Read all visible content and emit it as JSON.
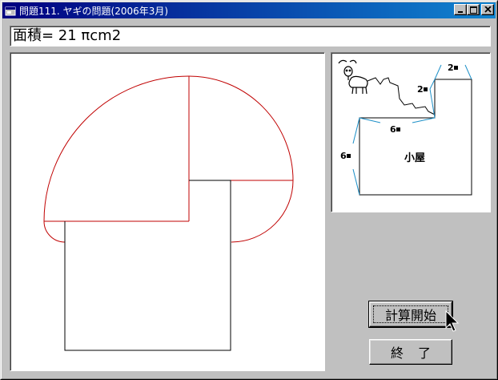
{
  "window": {
    "title": "問題111. ヤギの問題(2006年3月)",
    "title_color": "#000080",
    "controls": [
      "minimize-icon",
      "maximize-icon",
      "close-icon"
    ]
  },
  "result": {
    "text": "面積= 21  πcm2"
  },
  "diagram": {
    "labels": {
      "top_right": "2",
      "right_step": "2",
      "top_edge": "6",
      "left_edge": "6",
      "hut": "小屋"
    },
    "line_color": "#1e90c8",
    "goat_icon": "goat-icon"
  },
  "canvas": {
    "circle_color": "#c00000",
    "square_color": "#000000"
  },
  "buttons": {
    "start_label": "計算開始",
    "end_label": "終了"
  }
}
